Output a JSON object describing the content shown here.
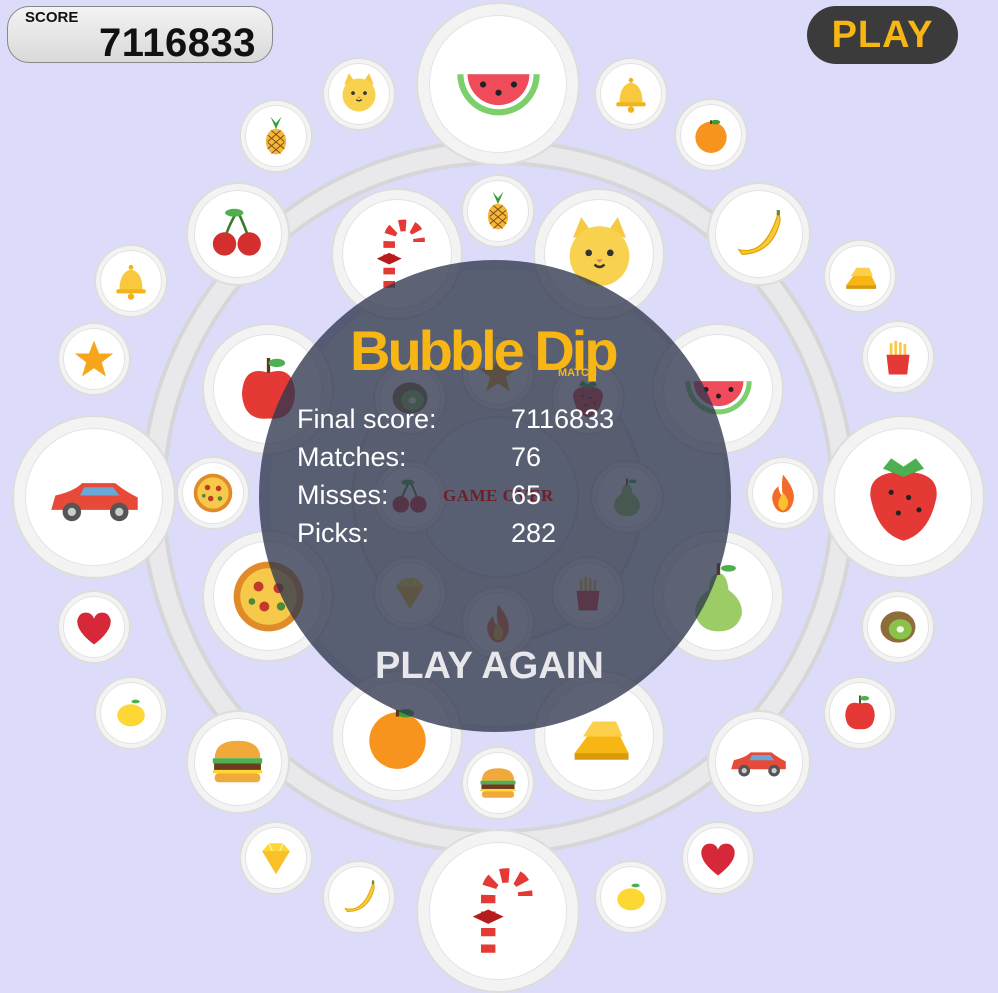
{
  "hud": {
    "score_label": "SCORE",
    "score_value": "7116833",
    "play_label": "PLAY"
  },
  "game_over_panel": {
    "logo_text": "Bubble Dip",
    "logo_sub": "MATCH",
    "stats": [
      {
        "label": "Final score:",
        "value": "7116833"
      },
      {
        "label": "Matches:",
        "value": "76"
      },
      {
        "label": "Misses:",
        "value": "65"
      },
      {
        "label": "Picks:",
        "value": "282"
      }
    ],
    "game_over_text": "GAME OVER",
    "play_again_label": "PLAY AGAIN"
  },
  "colors": {
    "background": "#dcdcfa",
    "accent_yellow": "#f7b614",
    "overlay": "#2f374e",
    "button_dark": "#3b3b3b"
  },
  "bubble_icons": [
    "watermelon-icon",
    "cat-icon",
    "bell-icon",
    "pineapple-icon",
    "orange-icon",
    "cherries-icon",
    "candy-cane-icon",
    "pineapple-icon",
    "cat-icon",
    "banana-icon",
    "bell-icon",
    "gold-bars-icon",
    "star-icon",
    "french-fries-icon",
    "apple-icon",
    "watermelon-icon",
    "car-icon",
    "pizza-icon",
    "strawberry-icon",
    "fire-icon",
    "pizza-icon",
    "pear-icon",
    "heart-icon",
    "kiwi-icon",
    "lemon-icon",
    "apple-icon",
    "orange-icon",
    "gold-bars-icon",
    "burger-icon",
    "car-icon",
    "burger-icon",
    "diamond-icon",
    "heart-icon",
    "banana-icon",
    "candy-cane-icon",
    "lemon-icon",
    "kiwi-icon",
    "star-icon",
    "cherries-icon",
    "pear-icon",
    "diamond-icon",
    "fire-icon",
    "strawberry-icon",
    "french-fries-icon"
  ]
}
